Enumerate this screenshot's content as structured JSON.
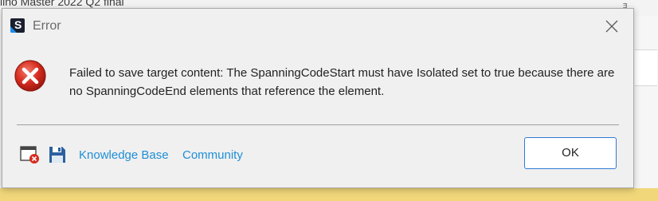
{
  "background": {
    "window_title": "lino Master 2022 Q2 final",
    "window_control": "ᴲ"
  },
  "dialog": {
    "title": "Error",
    "message": "Failed to save target content: The SpanningCodeStart must have Isolated set to true because there are no SpanningCodeEnd elements that reference the element.",
    "icons": {
      "app": "app-logo-icon",
      "close": "close-icon",
      "error": "error-icon",
      "report": "error-report-icon",
      "save": "save-icon"
    },
    "links": {
      "knowledge_base": "Knowledge Base",
      "community": "Community"
    },
    "ok_label": "OK"
  },
  "colors": {
    "link": "#1e8fd6",
    "error_red": "#d52b1e",
    "ok_border": "#2f7bd6",
    "background_yellow": "#f1d77a"
  }
}
